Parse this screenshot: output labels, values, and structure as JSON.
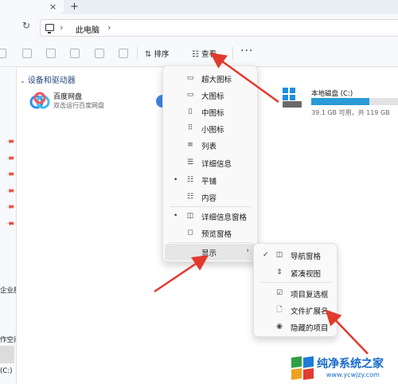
{
  "tabs": {
    "close_glyph": "×",
    "new_glyph": "+"
  },
  "address": {
    "refresh_glyph": "↻",
    "separator": "›",
    "location": "此电脑"
  },
  "toolbar": {
    "sort_icon_glyph": "⇅",
    "sort_label": "排序",
    "view_icon_glyph": "☷",
    "view_label": "查看",
    "more_glyph": "···"
  },
  "sidebar": {
    "pin_glyph": "📌",
    "frag1": "企业服",
    "frag2": "作空间",
    "frag3": "(C:)"
  },
  "main": {
    "section_title": "设备和驱动器",
    "section_chevron": "⌄",
    "baidu": {
      "name": "百度网盘",
      "subtitle": "双击运行百度网盘"
    },
    "drive": {
      "name": "本地磁盘 (C:)",
      "info": "39.1 GB 可用，共 119 GB",
      "used_fraction": 0.67
    }
  },
  "view_menu": {
    "items": [
      {
        "label": "超大图标",
        "icon": "monitor-icon",
        "glyph": "▭",
        "selected": false
      },
      {
        "label": "大图标",
        "icon": "large-icon",
        "glyph": "▭",
        "selected": false
      },
      {
        "label": "中图标",
        "icon": "medium-icon",
        "glyph": "▯",
        "selected": false
      },
      {
        "label": "小图标",
        "icon": "small-icons-icon",
        "glyph": "⠿",
        "selected": false
      },
      {
        "label": "列表",
        "icon": "list-icon",
        "glyph": "≡",
        "selected": false
      },
      {
        "label": "详细信息",
        "icon": "details-icon",
        "glyph": "☰",
        "selected": false
      },
      {
        "label": "平铺",
        "icon": "tiles-icon",
        "glyph": "☷",
        "selected": true
      },
      {
        "label": "内容",
        "icon": "content-icon",
        "glyph": "☷",
        "selected": false
      },
      {
        "label": "详细信息窗格",
        "icon": "details-pane-icon",
        "glyph": "◫",
        "selected": true
      },
      {
        "label": "预览窗格",
        "icon": "preview-pane-icon",
        "glyph": "◻",
        "selected": false
      },
      {
        "label": "显示",
        "icon": "",
        "glyph": "",
        "selected": false,
        "has_submenu": true
      }
    ],
    "bullet_glyph": "•",
    "submenu_arrow": "›"
  },
  "show_submenu": {
    "check_glyph": "✓",
    "items": [
      {
        "label": "导航窗格",
        "icon": "nav-pane-icon",
        "glyph": "◫",
        "checked": true
      },
      {
        "label": "紧凑视图",
        "icon": "compact-view-icon",
        "glyph": "⇕",
        "checked": false
      },
      {
        "label": "项目复选框",
        "icon": "item-checkbox-icon",
        "glyph": "☑",
        "checked": false
      },
      {
        "label": "文件扩展名",
        "icon": "file-extension-icon",
        "glyph": "🗋",
        "checked": false
      },
      {
        "label": "隐藏的项目",
        "icon": "hidden-items-icon",
        "glyph": "◉",
        "checked": false
      }
    ]
  },
  "watermark": {
    "title": "纯净系统之家",
    "url": "www.ycwjzy.com",
    "colors": [
      "#2ea043",
      "#1f7bd6",
      "#f0a020",
      "#e03c31"
    ]
  },
  "colors": {
    "accent": "#2a9bd8",
    "annotation": "#e23a2e"
  }
}
